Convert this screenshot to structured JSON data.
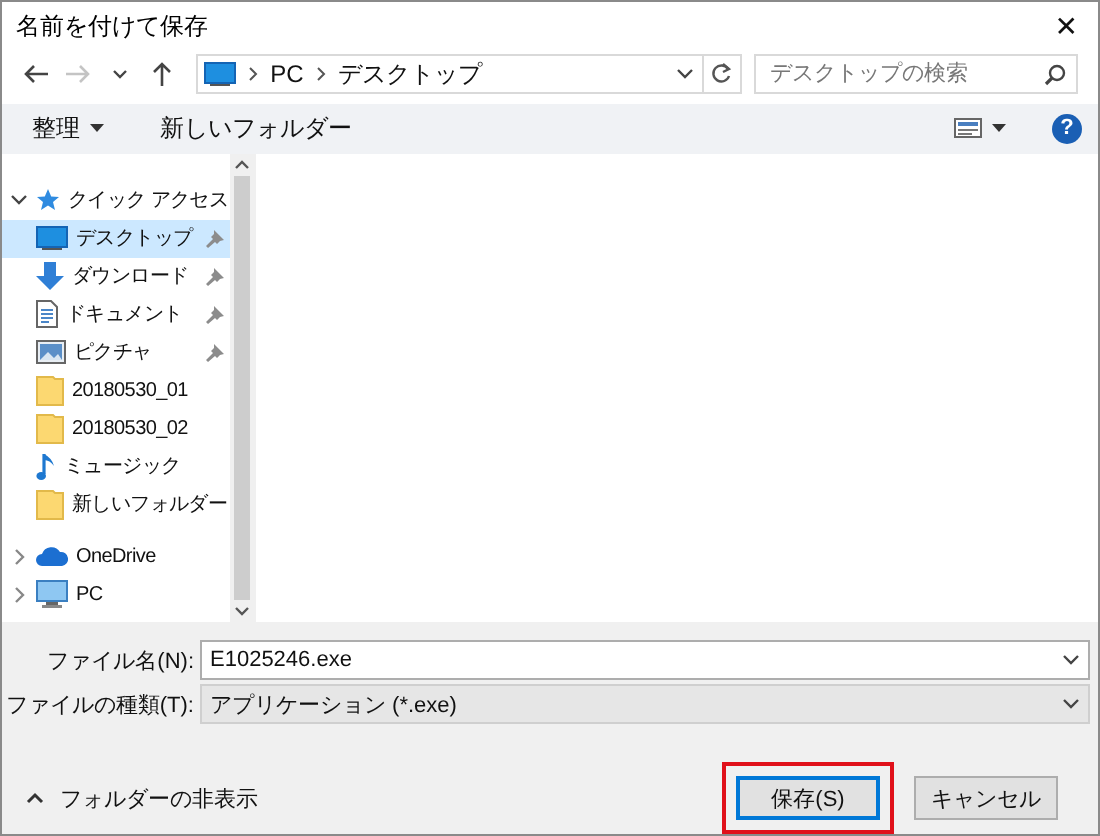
{
  "window": {
    "title": "名前を付けて保存",
    "close": "✕"
  },
  "navigation": {
    "buttons": [
      {
        "kind": "back",
        "disabled": false
      },
      {
        "kind": "forward",
        "disabled": true
      },
      {
        "kind": "recent",
        "disabled": false
      },
      {
        "kind": "up",
        "disabled": false
      }
    ],
    "address": {
      "segments": [
        "PC",
        "デスクトップ"
      ]
    },
    "search": {
      "placeholder": "デスクトップの検索"
    }
  },
  "toolbar": {
    "organize": "整理",
    "new_folder": "新しいフォルダー",
    "help": "?"
  },
  "sidebar": {
    "items": [
      {
        "label": "クイック アクセス",
        "kind": "star",
        "expanded": true,
        "selected": false,
        "children": [
          {
            "label": "デスクトップ",
            "kind": "desktop",
            "pinned": true,
            "selected": true
          },
          {
            "label": "ダウンロード",
            "kind": "download",
            "pinned": true,
            "selected": false
          },
          {
            "label": "ドキュメント",
            "kind": "document",
            "pinned": true,
            "selected": false
          },
          {
            "label": "ピクチャ",
            "kind": "picture",
            "pinned": true,
            "selected": false
          },
          {
            "label": "20180530_01",
            "kind": "folder",
            "pinned": false,
            "selected": false
          },
          {
            "label": "20180530_02",
            "kind": "folder",
            "pinned": false,
            "selected": false
          },
          {
            "label": "ミュージック",
            "kind": "music",
            "pinned": false,
            "selected": false
          },
          {
            "label": "新しいフォルダー",
            "kind": "folder",
            "pinned": false,
            "selected": false
          }
        ]
      },
      {
        "label": "OneDrive",
        "kind": "cloud",
        "expanded": false,
        "selected": false
      },
      {
        "label": "PC",
        "kind": "computer",
        "expanded": false,
        "selected": false
      }
    ]
  },
  "form": {
    "file_name": {
      "label": "ファイル名(N):",
      "value": "E1025246.exe"
    },
    "file_type": {
      "label": "ファイルの種類(T):",
      "value": "アプリケーション (*.exe)"
    }
  },
  "footer": {
    "hide_folders": "フォルダーの非表示",
    "buttons": [
      {
        "label": "保存(S)",
        "default": true,
        "highlighted": true
      },
      {
        "label": "キャンセル",
        "default": false,
        "highlighted": false
      }
    ]
  }
}
